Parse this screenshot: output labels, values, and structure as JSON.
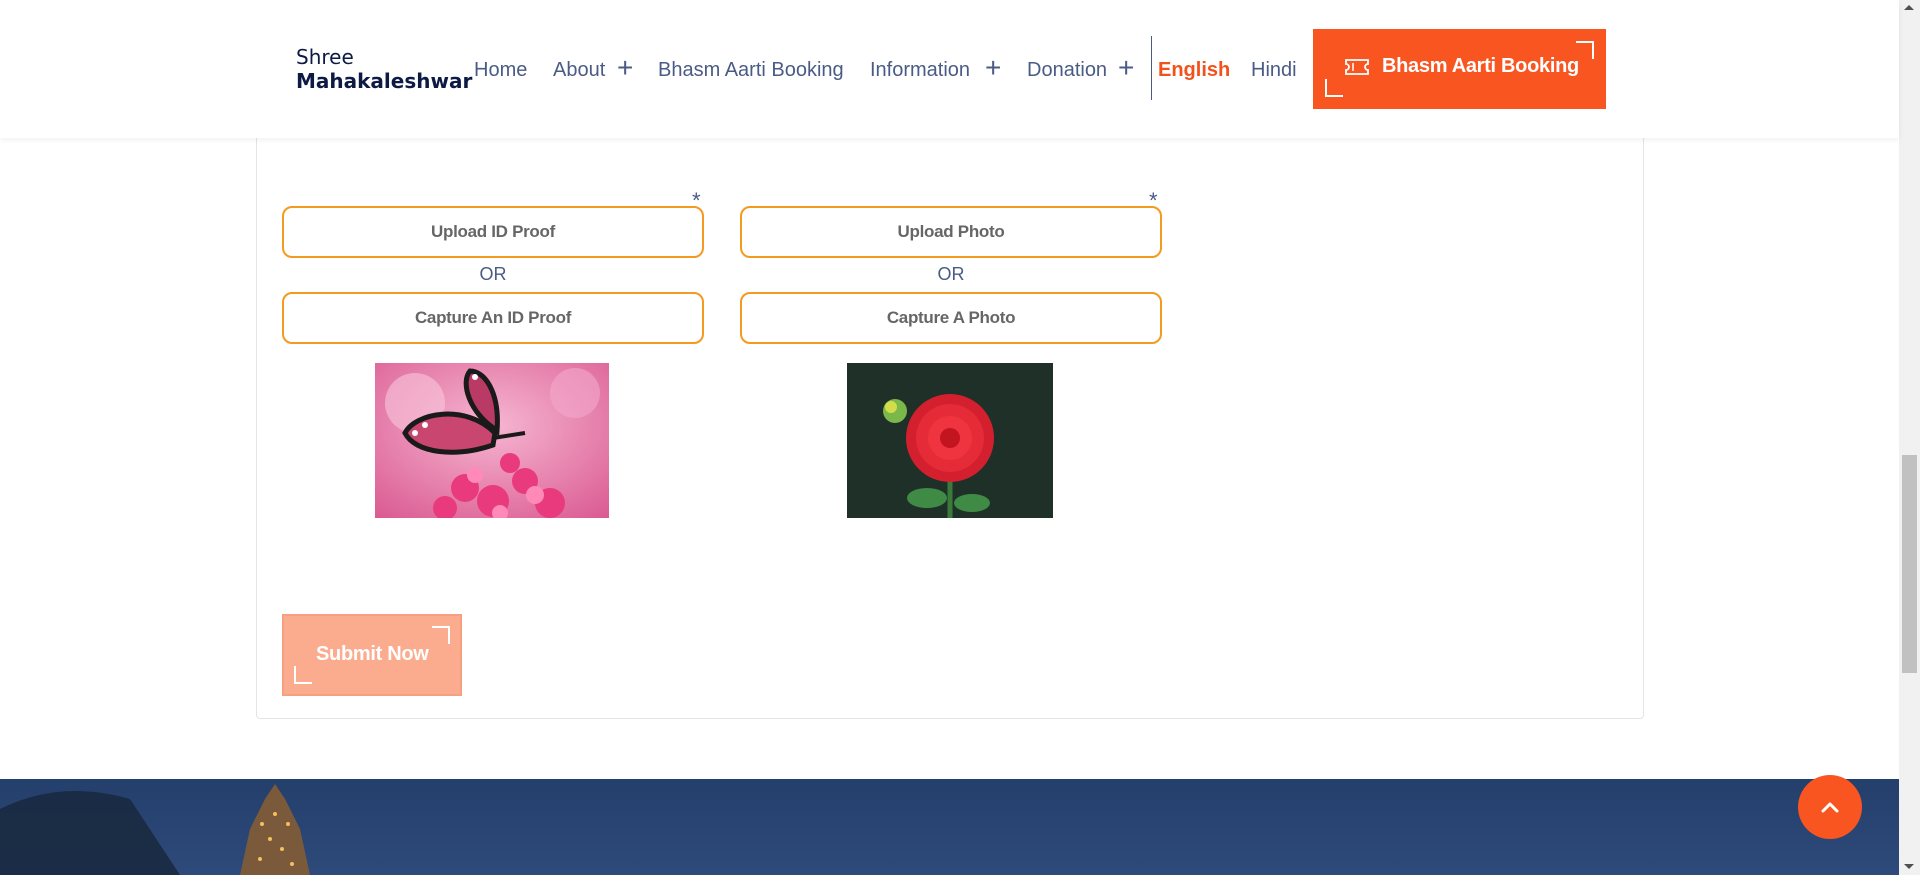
{
  "header": {
    "logo_line1": "Shree",
    "logo_line2": "Mahakaleshwar",
    "nav": {
      "home": "Home",
      "about": "About",
      "bhasm": "Bhasm Aarti Booking",
      "information": "Information",
      "donation": "Donation"
    },
    "lang_english": "English",
    "lang_hindi": "Hindi",
    "cta_label": "Bhasm Aarti Booking",
    "colors": {
      "accent": "#f95521",
      "nav_text": "#4a5b86",
      "border": "#f39a1f"
    }
  },
  "form": {
    "required_mark": "*",
    "upload_id_label": "Upload ID Proof",
    "upload_photo_label": "Upload Photo",
    "or_text": "OR",
    "capture_id_label": "Capture An ID Proof",
    "capture_photo_label": "Capture A Photo",
    "submit_label": "Submit Now"
  },
  "icons": {
    "plus": "plus-icon",
    "ticket": "ticket-icon",
    "scroll_top": "chevron-up-icon"
  }
}
